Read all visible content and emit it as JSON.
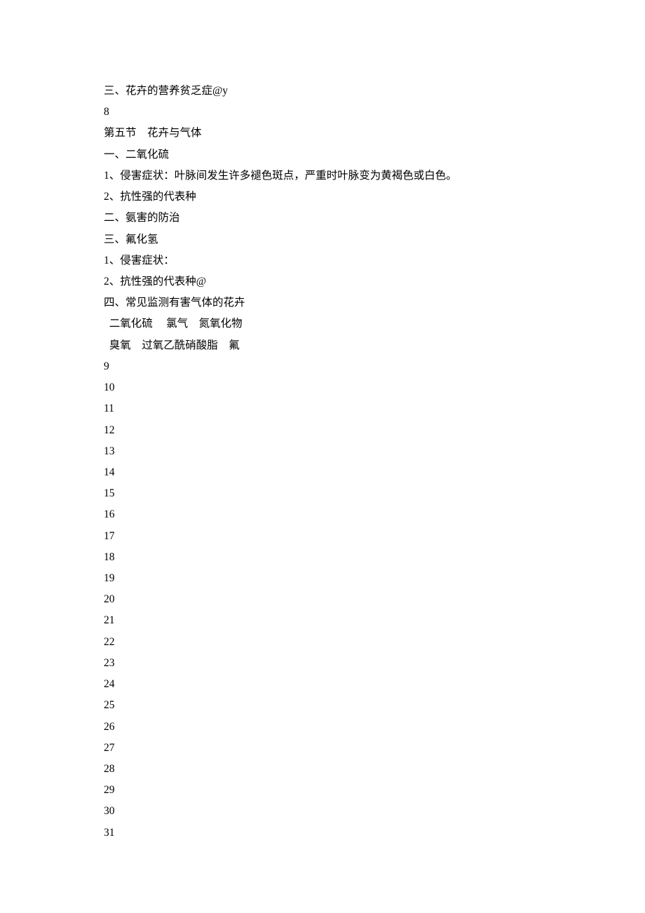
{
  "lines": [
    "三、花卉的营养贫乏症@y",
    "8",
    "第五节    花卉与气体",
    "一、二氧化硫",
    "1、侵害症状：叶脉间发生许多褪色斑点，严重时叶脉变为黄褐色或白色。",
    "2、抗性强的代表种",
    "二、氨害的防治",
    "三、氟化氢",
    "1、侵害症状：",
    "2、抗性强的代表种@",
    "四、常见监测有害气体的花卉",
    "  二氧化硫     氯气    氮氧化物",
    "  臭氧    过氧乙酰硝酸脂    氟",
    "9",
    "10",
    "11",
    "12",
    "13",
    "14",
    "15",
    "16",
    "17",
    "18",
    "19",
    "20",
    "21",
    "22",
    "23",
    "24",
    "25",
    "26",
    "27",
    "28",
    "29",
    "30",
    "31"
  ]
}
